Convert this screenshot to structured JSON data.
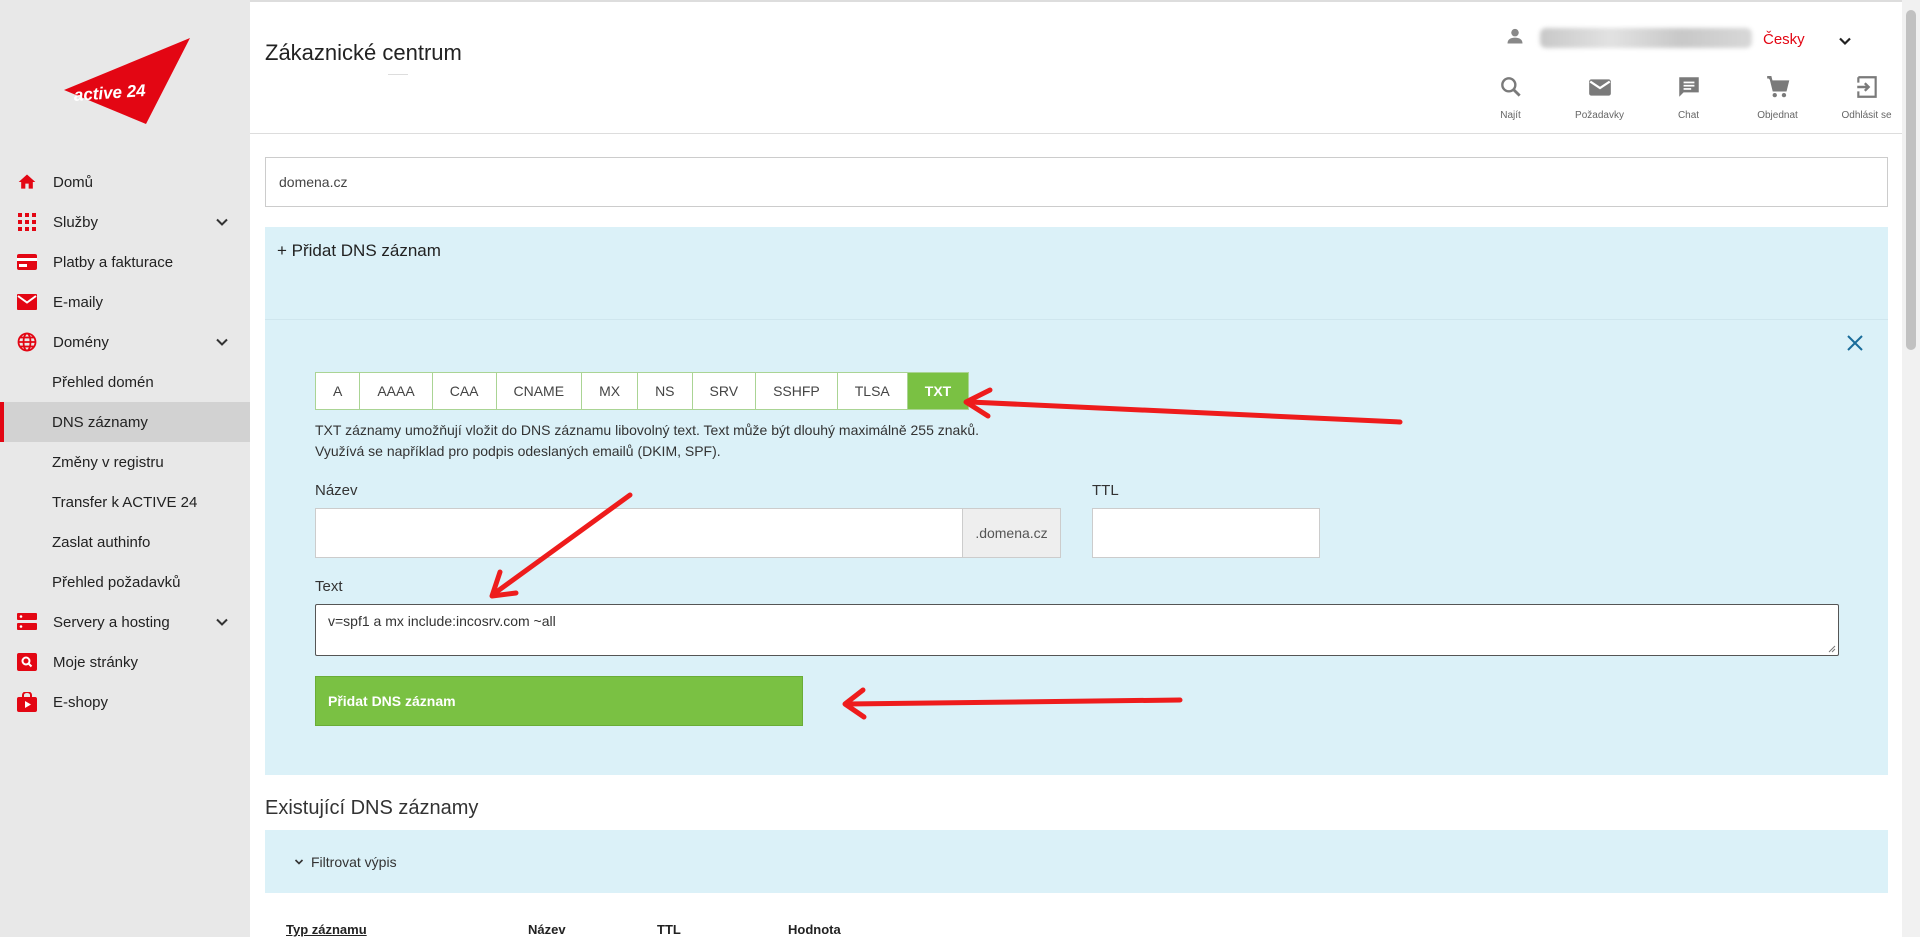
{
  "app": {
    "title": "Zákaznické centrum",
    "brand": "active 24",
    "accent_color": "#e30613",
    "green_color": "#7ac143"
  },
  "sidebar": {
    "items": [
      {
        "label": "Domů",
        "icon": "home-icon"
      },
      {
        "label": "Služby",
        "icon": "grid-icon"
      },
      {
        "label": "Platby a fakturace",
        "icon": "credit-card-icon"
      },
      {
        "label": "E-maily",
        "icon": "mail-icon"
      },
      {
        "label": "Domény",
        "icon": "globe-icon"
      },
      {
        "label": "Přehled domén"
      },
      {
        "label": "DNS záznamy"
      },
      {
        "label": "Změny v registru"
      },
      {
        "label": "Transfer k ACTIVE 24"
      },
      {
        "label": "Zaslat authinfo"
      },
      {
        "label": "Přehled požadavků"
      },
      {
        "label": "Servery a hosting",
        "icon": "server-icon"
      },
      {
        "label": "Moje stránky",
        "icon": "web-search-icon"
      },
      {
        "label": "E-shopy",
        "icon": "shop-bag-icon"
      }
    ]
  },
  "header": {
    "language": "Česky",
    "tools": [
      {
        "label": "Najít",
        "icon": "search-icon"
      },
      {
        "label": "Požadavky",
        "icon": "mail-icon"
      },
      {
        "label": "Chat",
        "icon": "chat-icon"
      },
      {
        "label": "Objednat",
        "icon": "cart-icon"
      },
      {
        "label": "Odhlásit se",
        "icon": "logout-icon"
      }
    ]
  },
  "main": {
    "domain": "domena.cz",
    "add_panel": {
      "heading": "+ Přidat DNS záznam",
      "types": [
        "A",
        "AAAA",
        "CAA",
        "CNAME",
        "MX",
        "NS",
        "SRV",
        "SSHFP",
        "TLSA",
        "TXT"
      ],
      "selected_type": "TXT",
      "description_line1": "TXT záznamy umožňují vložit do DNS záznamu libovolný text. Text může být dlouhý maximálně 255 znaků.",
      "description_line2": "Využívá se například pro podpis odeslaných emailů (DKIM, SPF).",
      "name_label": "Název",
      "name_suffix": ".domena.cz",
      "ttl_label": "TTL",
      "text_label": "Text",
      "text_value": "v=spf1 a mx include:incosrv.com ~all",
      "submit_label": "Přidat DNS záznam"
    },
    "existing": {
      "title": "Existující DNS záznamy",
      "filter_label": "Filtrovat výpis",
      "columns": [
        "Typ záznamu",
        "Název",
        "TTL",
        "Hodnota"
      ]
    }
  }
}
